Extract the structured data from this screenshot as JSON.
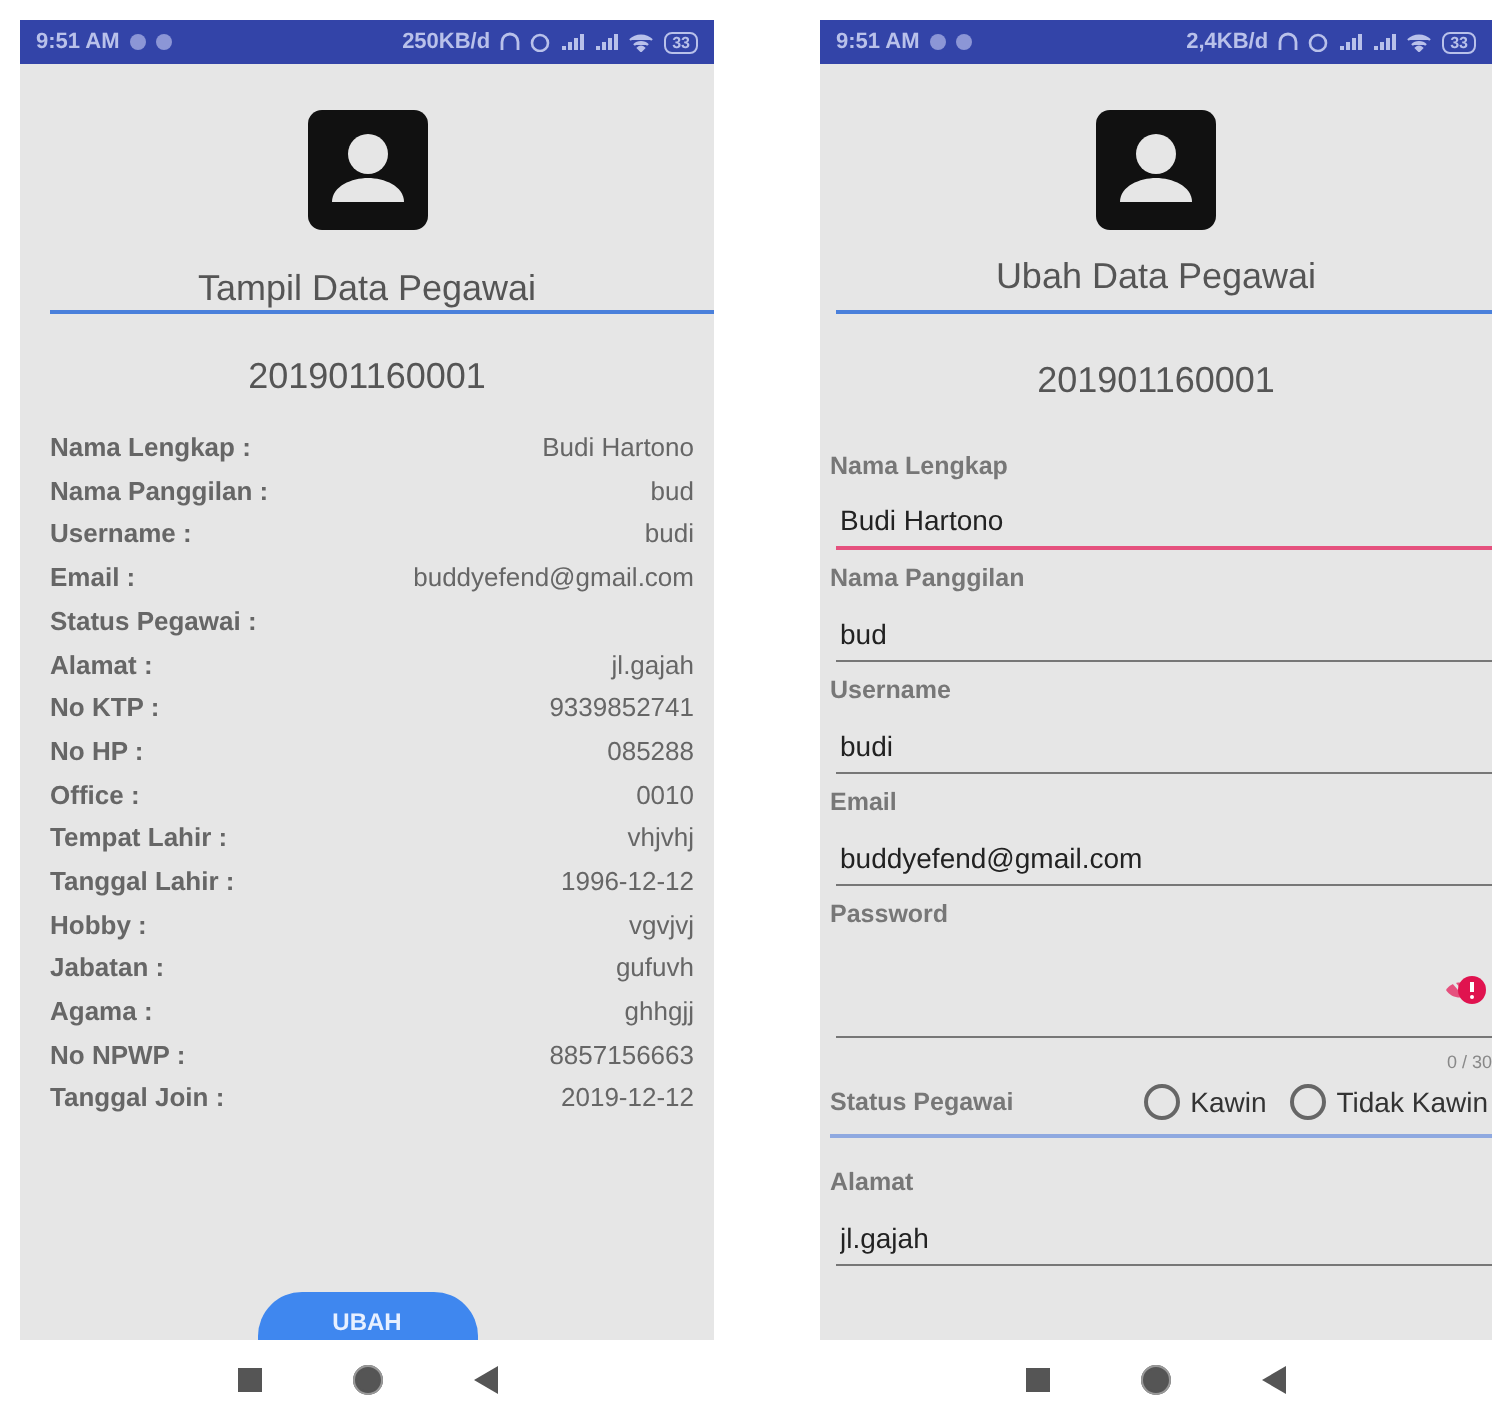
{
  "view_screen": {
    "status_bar": {
      "time": "9:51 AM",
      "speed": "250KB/d",
      "battery": "33"
    },
    "title": "Tampil Data Pegawai",
    "employee_id": "201901160001",
    "details": [
      {
        "label": "Nama Lengkap :",
        "value": "Budi Hartono"
      },
      {
        "label": "Nama Panggilan :",
        "value": "bud"
      },
      {
        "label": "Username :",
        "value": "budi"
      },
      {
        "label": "Email :",
        "value": "buddyefend@gmail.com"
      },
      {
        "label": "Status Pegawai :"
      },
      {
        "label": "Alamat :",
        "value": "jl.gajah"
      },
      {
        "label": "No KTP :",
        "value": "9339852741"
      },
      {
        "label": "No HP :",
        "value": "085288"
      },
      {
        "label": "Office :",
        "value": "0010"
      },
      {
        "label": "Tempat Lahir :",
        "value": "vhjvhj"
      },
      {
        "label": "Tanggal Lahir :",
        "value": "1996-12-12"
      },
      {
        "label": "Hobby :",
        "value": "vgvjvj"
      },
      {
        "label": "Jabatan :",
        "value": "gufuvh"
      },
      {
        "label": "Agama :",
        "value": "ghhgjj"
      },
      {
        "label": "No NPWP :",
        "value": "8857156663"
      },
      {
        "label": "Tanggal Join :",
        "value": "2019-12-12"
      }
    ],
    "button": "UBAH"
  },
  "edit_screen": {
    "status_bar": {
      "time": "9:51 AM",
      "speed": "2,4KB/d",
      "battery": "33"
    },
    "title": "Ubah Data Pegawai",
    "employee_id": "201901160001",
    "fields": [
      {
        "kind": "text",
        "label": "Nama Lengkap",
        "value": "Budi Hartono",
        "focused": true
      },
      {
        "kind": "text",
        "label": "Nama Panggilan",
        "value": "bud",
        "focused": false
      },
      {
        "kind": "text",
        "label": "Username",
        "value": "budi",
        "focused": false
      },
      {
        "kind": "text",
        "label": "Email",
        "value": "buddyefend@gmail.com",
        "focused": false
      },
      {
        "kind": "password",
        "label": "Password",
        "counter": "0 / 30",
        "error": true,
        "focused": false
      },
      {
        "kind": "radio",
        "label": "Status Pegawai",
        "options": [
          {
            "label": "Kawin",
            "selected": false
          },
          {
            "label": "Tidak Kawin",
            "selected": false
          }
        ]
      },
      {
        "kind": "text",
        "label": "Alamat",
        "value": "jl.gajah",
        "focused": false
      }
    ]
  }
}
